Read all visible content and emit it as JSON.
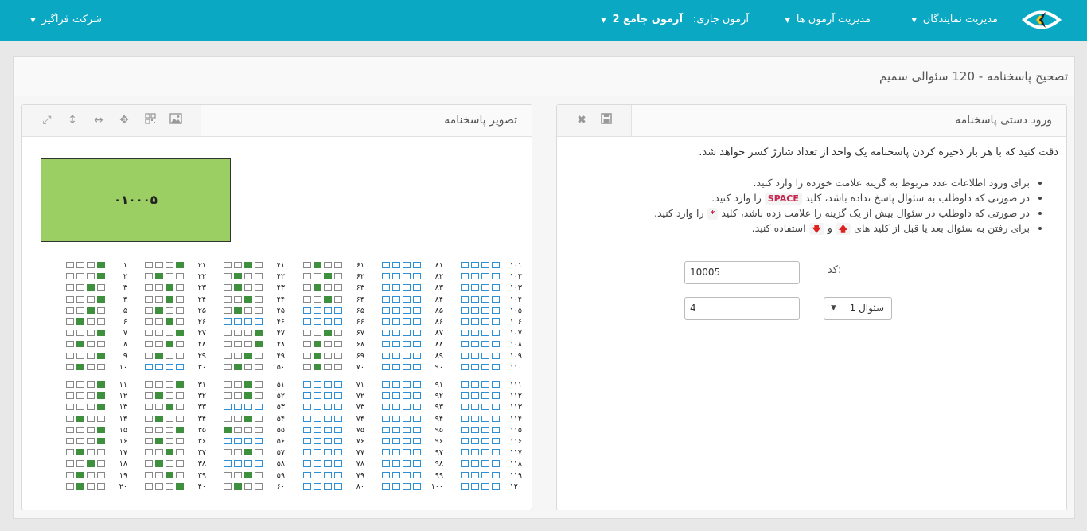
{
  "topbar": {
    "company": "شرکت فراگیر",
    "current_exam_label": "آزمون جاری:",
    "current_exam_value": "آزمون جامع 2",
    "menu_exams": "مدیریت آزمون ها",
    "menu_agents": "مدیریت نمایندگان",
    "accent_color": "#0aa8c3"
  },
  "page": {
    "title": "تصحیح پاسخنامه - 120 سئوالی سمیم"
  },
  "manual_panel": {
    "title": "ورود دستی پاسخنامه",
    "notice": "دقت کنید که با هر بار ذخیره کردن پاسخنامه یک واحد از تعداد شارژ کسر خواهد شد.",
    "bullet1": "برای ورود اطلاعات عدد مربوط به گزینه علامت خورده را وارد کنید.",
    "bullet2_pre": "در صورتی که داوطلب به سئوال پاسخ نداده باشد، کلید",
    "bullet2_key": "SPACE",
    "bullet2_post": "را وارد کنید.",
    "bullet3_pre": "در صورتی که داوطلب در سئوال بیش از یک گزینه را علامت زده باشد، کلید",
    "bullet3_key": "*",
    "bullet3_post": "را وارد کنید.",
    "bullet4_pre": "برای رفتن به سئوال بعد یا قبل از کلید های",
    "bullet4_key_up": "🡅",
    "bullet4_mid": "و",
    "bullet4_key_down": "🡇",
    "bullet4_post": "استفاده کنید.",
    "code_label": "کد:",
    "code_value": "10005",
    "question_select": "سئوال 1",
    "answer_value": "4",
    "icons": [
      "close-icon",
      "save-icon"
    ]
  },
  "image_panel": {
    "title": "تصویر پاسخنامه",
    "code_box_value": "۰۱۰۰۰۵",
    "code_box_color": "#9ccf63",
    "icons": [
      "expand-icon",
      "fit-height-icon",
      "fit-width-icon",
      "fullscreen-icon",
      "qr-icon",
      "image-icon"
    ]
  },
  "answer_sheet": {
    "digits": "۰۱۲۳۴۵۶۷۸۹",
    "filled_color": "#3e8f3e",
    "blank_border_color": "#2d8fd6",
    "answers": [
      4,
      4,
      3,
      4,
      3,
      2,
      4,
      2,
      4,
      2,
      4,
      4,
      4,
      2,
      4,
      4,
      2,
      3,
      2,
      2,
      4,
      2,
      3,
      3,
      2,
      3,
      4,
      3,
      2,
      0,
      4,
      2,
      3,
      2,
      4,
      2,
      3,
      2,
      3,
      4,
      3,
      2,
      2,
      3,
      2,
      0,
      4,
      4,
      3,
      2,
      3,
      3,
      0,
      3,
      1,
      0,
      3,
      0,
      3,
      2,
      2,
      3,
      2,
      3,
      0,
      0,
      3,
      2,
      2,
      2,
      0,
      0,
      0,
      0,
      0,
      0,
      0,
      0,
      0,
      0,
      0,
      0,
      0,
      0,
      0,
      0,
      0,
      0,
      0,
      0,
      0,
      0,
      0,
      0,
      0,
      0,
      0,
      0,
      0,
      0,
      0,
      0,
      0,
      0,
      0,
      0,
      0,
      0,
      0,
      0,
      0,
      0,
      0,
      0,
      0,
      0,
      0,
      0,
      0,
      0
    ]
  }
}
